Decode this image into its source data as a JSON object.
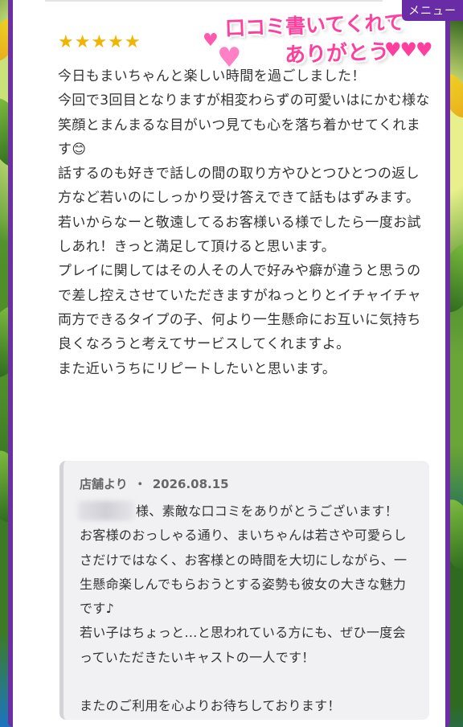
{
  "menu_label": "メニュー",
  "banner": {
    "line1": "口コミ書いてくれて",
    "line2": "ありがとう",
    "hearts": "♥♥♥"
  },
  "rating": {
    "stars": "★★★★★",
    "value": 5,
    "max": 5
  },
  "review": {
    "paragraphs": [
      "今日もまいちゃんと楽しい時間を過ごしました！",
      "今回で3回目となりますが相変わらずの可愛いはにかむ様な笑顔とまんまるな目がいつ見ても心を落ち着かせてくれます😊",
      "話するのも好きで話しの間の取り方やひとつひとつの返し方など若いのにしっかり受け答えできて話もはずみます。",
      "若いからなーと敬遠してるお客様いる様でしたら一度お試しあれ！きっと満足して頂けると思います。",
      "プレイに関してはその人その人で好みや癖が違うと思うので差し控えさせていただきますがねっとりとイチャイチャ両方できるタイプの子、何より一生懸命にお互いに気持ち良くなろうと考えてサービスしてくれますよ。",
      "また近いうちにリピートしたいと思います。"
    ]
  },
  "reply": {
    "from": "店舗より",
    "separator": "・",
    "date": "2026.08.15",
    "paragraphs": [
      "様、素敵な口コミをありがとうございます！",
      "お客様のおっしゃる通り、まいちゃんは若さや可愛らしさだけではなく、お客様との時間を大切にしながら、一生懸命楽しんでもらおうとする姿勢も彼女の大きな魅力です♪",
      "若い子はちょっと…と思われている方にも、ぜひ一度会っていただきたいキャストの一人です！",
      "またのご利用を心よりお待ちしております！"
    ]
  },
  "colors": {
    "frame": "#6b2fa3",
    "star": "#f2b400",
    "banner_pink": "#ff3f9d",
    "reply_bg": "#f1f1f3"
  }
}
